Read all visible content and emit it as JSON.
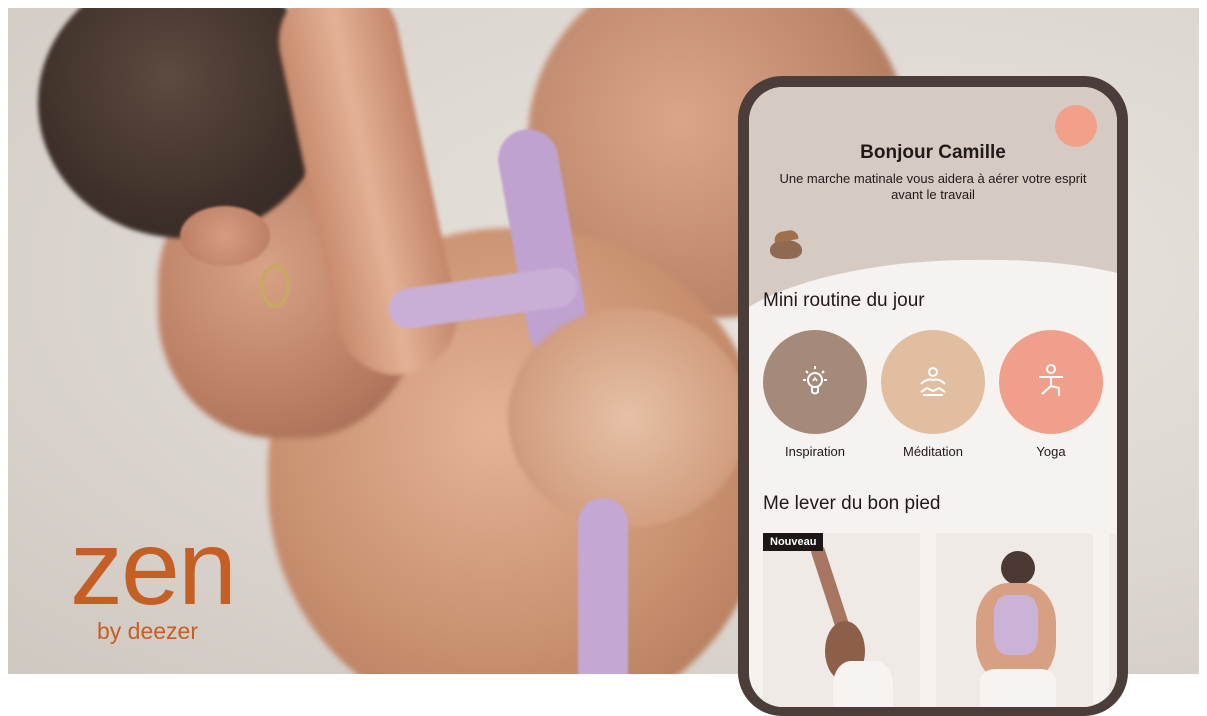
{
  "brand": {
    "name": "zen",
    "tagline": "by deezer",
    "color": "#c45f26"
  },
  "app": {
    "greeting": "Bonjour Camille",
    "subtitle": "Une marche matinale vous aidera à aérer votre esprit avant le travail",
    "section_routine": "Mini routine du jour",
    "routine": [
      {
        "label": "Inspiration",
        "icon": "lightbulb-icon",
        "color": "#a68a79"
      },
      {
        "label": "Méditation",
        "icon": "meditation-icon",
        "color": "#e2bea1"
      },
      {
        "label": "Yoga",
        "icon": "yoga-icon",
        "color": "#f0a08a"
      }
    ],
    "section_morning": "Me lever du bon pied",
    "cards": [
      {
        "badge": "Nouveau"
      }
    ]
  }
}
